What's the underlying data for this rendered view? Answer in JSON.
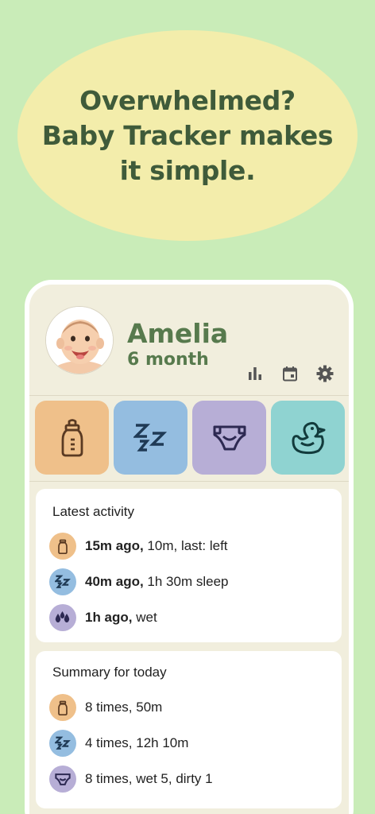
{
  "promo": {
    "line1": "Overwhelmed?",
    "line2": "Baby Tracker makes",
    "line3": "it simple."
  },
  "profile": {
    "name": "Amelia",
    "age": "6 month"
  },
  "header_icons": [
    "bar-chart-icon",
    "calendar-icon",
    "settings-gear-icon"
  ],
  "tiles": [
    {
      "name": "feeding",
      "icon": "baby-bottle-icon",
      "color": "#efc08a"
    },
    {
      "name": "sleep",
      "icon": "sleep-zzz-icon",
      "color": "#94bde0"
    },
    {
      "name": "diaper",
      "icon": "diaper-icon",
      "color": "#b7aed6"
    },
    {
      "name": "bath",
      "icon": "rubber-duck-icon",
      "color": "#8fd3d1"
    }
  ],
  "latest": {
    "title": "Latest activity",
    "items": [
      {
        "icon": "baby-bottle-icon",
        "when": "15m ago,",
        "detail": " 10m, last: left"
      },
      {
        "icon": "sleep-zzz-icon",
        "when": "40m ago,",
        "detail": " 1h 30m sleep"
      },
      {
        "icon": "water-drops-icon",
        "when": "1h ago,",
        "detail": " wet"
      }
    ]
  },
  "summary": {
    "title": "Summary for today",
    "items": [
      {
        "icon": "baby-bottle-icon",
        "text": "8 times, 50m"
      },
      {
        "icon": "sleep-zzz-icon",
        "text": "4 times, 12h 10m"
      },
      {
        "icon": "diaper-icon",
        "text": "8 times, wet 5, dirty 1"
      }
    ]
  },
  "colors": {
    "background": "#c9ecb8",
    "ellipse": "#f3edab",
    "headline": "#3f5b3a",
    "profile_text": "#577a4d",
    "feeding": "#efc08a",
    "sleep": "#94bde0",
    "diaper": "#b7aed6",
    "bath": "#8fd3d1"
  }
}
